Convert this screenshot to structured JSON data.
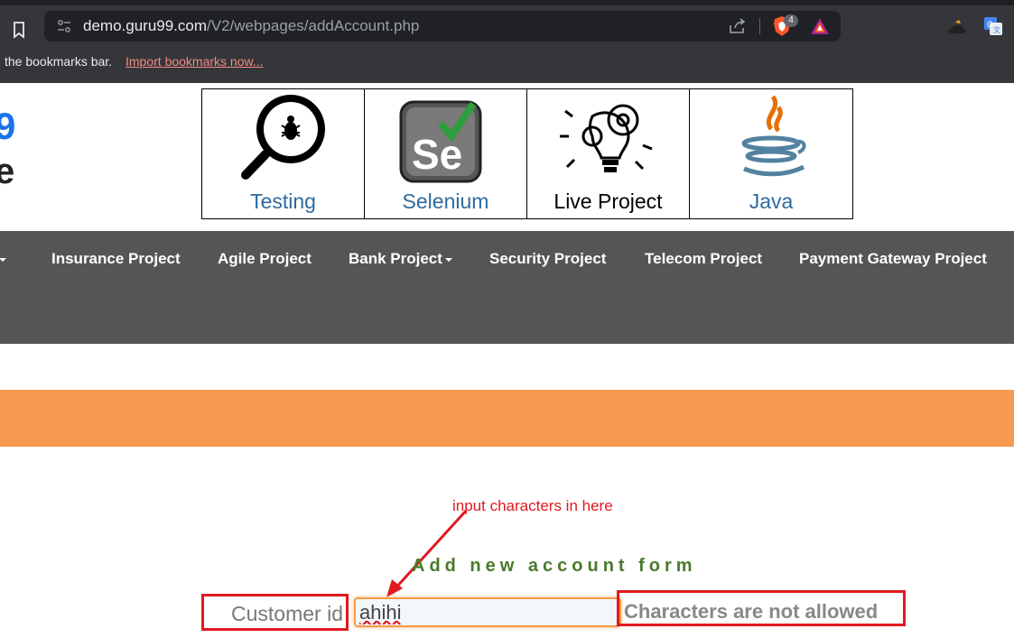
{
  "browser": {
    "url_host": "demo.guru99.com",
    "url_path": "/V2/webpages/addAccount.php",
    "brave_badge_count": "4",
    "bookmarks_bar_text": "the bookmarks bar.",
    "import_bookmarks_link": "Import bookmarks now..."
  },
  "site": {
    "logo_fragment_1": "9",
    "logo_fragment_2": "e"
  },
  "banner": {
    "items": [
      {
        "label": "Testing",
        "icon": "magnifier-bug-icon"
      },
      {
        "label": "Selenium",
        "icon": "selenium-logo-icon"
      },
      {
        "label": "Live Project",
        "icon": "lightbulb-gear-icon"
      },
      {
        "label": "Java",
        "icon": "java-cup-icon"
      }
    ]
  },
  "nav": {
    "items": [
      {
        "label": "",
        "dropdown": true
      },
      {
        "label": "Insurance Project"
      },
      {
        "label": "Agile Project"
      },
      {
        "label": "Bank Project",
        "dropdown": true
      },
      {
        "label": "Security Project"
      },
      {
        "label": "Telecom Project"
      },
      {
        "label": "Payment Gateway Project"
      }
    ]
  },
  "annotation": {
    "text": "input characters in here",
    "color": "#e0191f"
  },
  "form": {
    "title": "Add new account form",
    "customer_id_label": "Customer id",
    "customer_id_value": "ahihi",
    "error_message": "Characters are not allowed"
  },
  "colors": {
    "navbar": "#555555",
    "orange_band": "#f79a50",
    "form_title": "#4a7a2a"
  }
}
